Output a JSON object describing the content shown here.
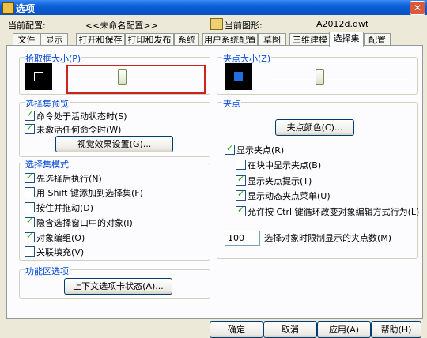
{
  "window": {
    "title": "选项",
    "close_glyph": "✕"
  },
  "profile": {
    "current_config_label": "当前配置:",
    "current_config_value": "<<未命名配置>>",
    "current_drawing_label": "当前图形:",
    "current_drawing_value": "A2012d.dwt"
  },
  "tabs": [
    "文件",
    "显示",
    "打开和保存",
    "打印和发布",
    "系统",
    "用户系统配置",
    "草图",
    "三维建模",
    "选择集",
    "配置"
  ],
  "active_tab": "选择集",
  "pickbox": {
    "title": "拾取框大小(P)",
    "slider_level": 0.41
  },
  "grip_size": {
    "title": "夹点大小(Z)",
    "slider_level": 0.35
  },
  "selection_preview": {
    "title": "选择集预览",
    "items": [
      {
        "label": "命令处于活动状态时(S)",
        "checked": true
      },
      {
        "label": "未激活任何命令时(W)",
        "checked": true
      }
    ],
    "visual_effects_button": "视觉效果设置(G)..."
  },
  "selection_modes": {
    "title": "选择集模式",
    "items": [
      {
        "label": "先选择后执行(N)",
        "checked": true
      },
      {
        "label": "用 Shift 键添加到选择集(F)",
        "checked": false
      },
      {
        "label": "按住并拖动(D)",
        "checked": false
      },
      {
        "label": "隐含选择窗口中的对象(I)",
        "checked": true
      },
      {
        "label": "对象编组(O)",
        "checked": true
      },
      {
        "label": "关联填充(V)",
        "checked": false
      }
    ]
  },
  "ribbon_options": {
    "title": "功能区选项",
    "button": "上下文选项卡状态(A)..."
  },
  "grips": {
    "title": "夹点",
    "grip_colors_button": "夹点颜色(C)...",
    "show_grips": {
      "label": "显示夹点(R)",
      "checked": true
    },
    "sub_items": [
      {
        "label": "在块中显示夹点(B)",
        "checked": false
      },
      {
        "label": "显示夹点提示(T)",
        "checked": true
      },
      {
        "label": "显示动态夹点菜单(U)",
        "checked": true
      },
      {
        "label": "允许按 Ctrl 键循环改变对象编辑方式行为(L)",
        "checked": true
      }
    ],
    "limit_value": "100",
    "limit_label": "选择对象时限制显示的夹点数(M)"
  },
  "footer": {
    "ok": "确定",
    "cancel": "取消",
    "apply": "应用(A)",
    "help": "帮助(H)"
  },
  "colors": {
    "accent_title": "#0046d5",
    "highlight_frame": "#cc2222",
    "grip_swatch": "#1f6fe0"
  }
}
